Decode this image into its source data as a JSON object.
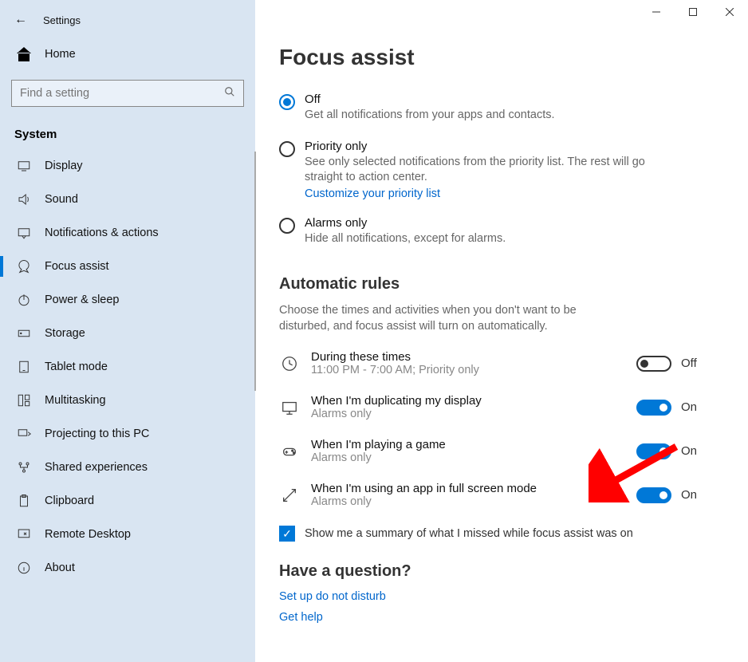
{
  "window": {
    "title": "Settings"
  },
  "sidebar": {
    "home": "Home",
    "search_placeholder": "Find a setting",
    "section": "System",
    "items": [
      {
        "label": "Display"
      },
      {
        "label": "Sound"
      },
      {
        "label": "Notifications & actions"
      },
      {
        "label": "Focus assist"
      },
      {
        "label": "Power & sleep"
      },
      {
        "label": "Storage"
      },
      {
        "label": "Tablet mode"
      },
      {
        "label": "Multitasking"
      },
      {
        "label": "Projecting to this PC"
      },
      {
        "label": "Shared experiences"
      },
      {
        "label": "Clipboard"
      },
      {
        "label": "Remote Desktop"
      },
      {
        "label": "About"
      }
    ]
  },
  "main": {
    "heading": "Focus assist",
    "radio": {
      "off": {
        "label": "Off",
        "desc": "Get all notifications from your apps and contacts."
      },
      "priority": {
        "label": "Priority only",
        "desc": "See only selected notifications from the priority list. The rest will go straight to action center.",
        "link": "Customize your priority list"
      },
      "alarms": {
        "label": "Alarms only",
        "desc": "Hide all notifications, except for alarms."
      }
    },
    "auto_heading": "Automatic rules",
    "auto_desc": "Choose the times and activities when you don't want to be disturbed, and focus assist will turn on automatically.",
    "rules": [
      {
        "title": "During these times",
        "sub": "11:00 PM - 7:00 AM; Priority only",
        "state": "Off"
      },
      {
        "title": "When I'm duplicating my display",
        "sub": "Alarms only",
        "state": "On"
      },
      {
        "title": "When I'm playing a game",
        "sub": "Alarms only",
        "state": "On"
      },
      {
        "title": "When I'm using an app in full screen mode",
        "sub": "Alarms only",
        "state": "On"
      }
    ],
    "summary_checkbox": "Show me a summary of what I missed while focus assist was on",
    "question_heading": "Have a question?",
    "help_links": [
      "Set up do not disturb",
      "Get help"
    ]
  }
}
